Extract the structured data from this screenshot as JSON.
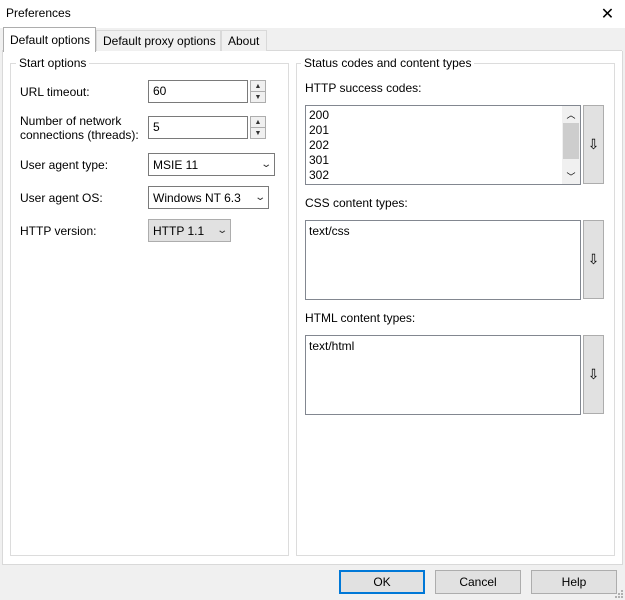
{
  "window": {
    "title": "Preferences",
    "close_glyph": "✕"
  },
  "tabs": [
    {
      "label": "Default options",
      "active": true
    },
    {
      "label": "Default proxy options",
      "active": false
    },
    {
      "label": "About",
      "active": false
    }
  ],
  "start_options": {
    "title": "Start options",
    "url_timeout": {
      "label": "URL timeout:",
      "value": "60"
    },
    "connections": {
      "label_line1": "Number of network",
      "label_line2": "connections (threads):",
      "value": "5"
    },
    "user_agent_type": {
      "label": "User agent type:",
      "value": "MSIE 11"
    },
    "user_agent_os": {
      "label": "User agent OS:",
      "value": "Windows NT 6.3"
    },
    "http_version": {
      "label": "HTTP version:",
      "value": "HTTP 1.1"
    }
  },
  "status_codes": {
    "title": "Status codes and content types",
    "http_success": {
      "label": "HTTP success codes:",
      "items": [
        "200",
        "201",
        "202",
        "301",
        "302"
      ]
    },
    "css_types": {
      "label": "CSS content types:",
      "items": [
        "text/css"
      ]
    },
    "html_types": {
      "label": "HTML content types:",
      "items": [
        "text/html"
      ]
    },
    "side_button_glyph": "⇩"
  },
  "icons": {
    "spin_up": "▲",
    "spin_down": "▼",
    "combo_arrow": "⌄",
    "scroll_up": "︿",
    "scroll_down": "﹀"
  },
  "footer": {
    "ok": "OK",
    "cancel": "Cancel",
    "help": "Help"
  },
  "colors": {
    "default_button_border": "#0078d7",
    "panel_bg": "#ffffff",
    "window_bg": "#f0f0f0"
  }
}
